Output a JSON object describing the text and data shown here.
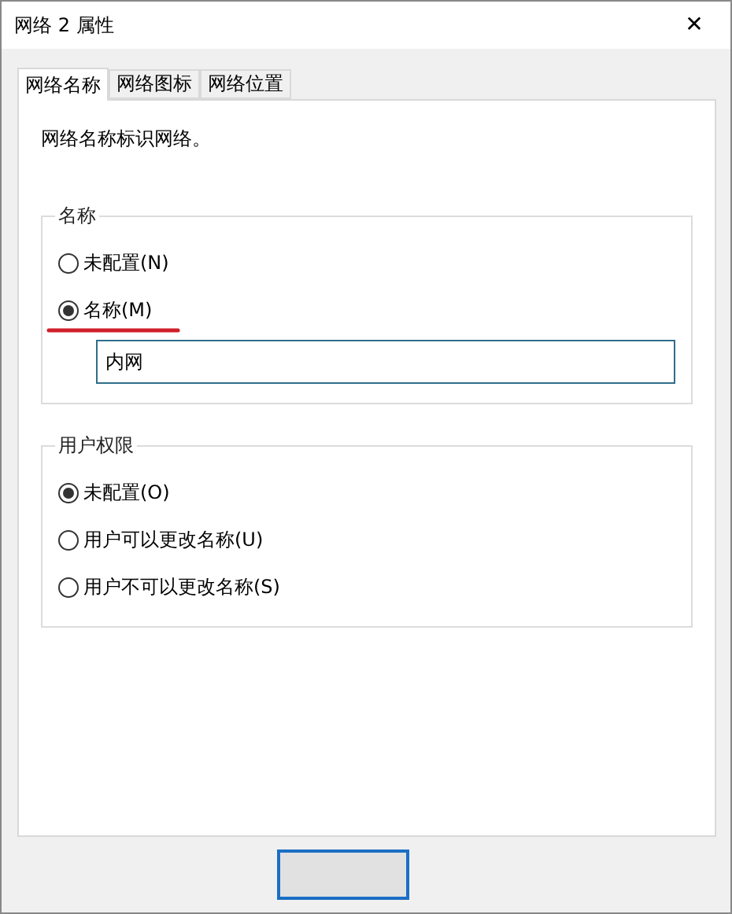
{
  "window": {
    "title": "网络 2 属性",
    "close": "✕"
  },
  "tabs": [
    {
      "label": "网络名称",
      "selected": true
    },
    {
      "label": "网络图标",
      "selected": false
    },
    {
      "label": "网络位置",
      "selected": false
    }
  ],
  "description": "网络名称标识网络。",
  "name_group": {
    "title": "名称",
    "options": [
      {
        "label": "未配置(N)",
        "selected": false,
        "marked": false
      },
      {
        "label": "名称(M)",
        "selected": true,
        "marked": true
      }
    ],
    "value": "内网"
  },
  "permission_group": {
    "title": "用户权限",
    "options": [
      {
        "label": "未配置(O)",
        "selected": true
      },
      {
        "label": "用户可以更改名称(U)",
        "selected": false
      },
      {
        "label": "用户不可以更改名称(S)",
        "selected": false
      }
    ]
  }
}
